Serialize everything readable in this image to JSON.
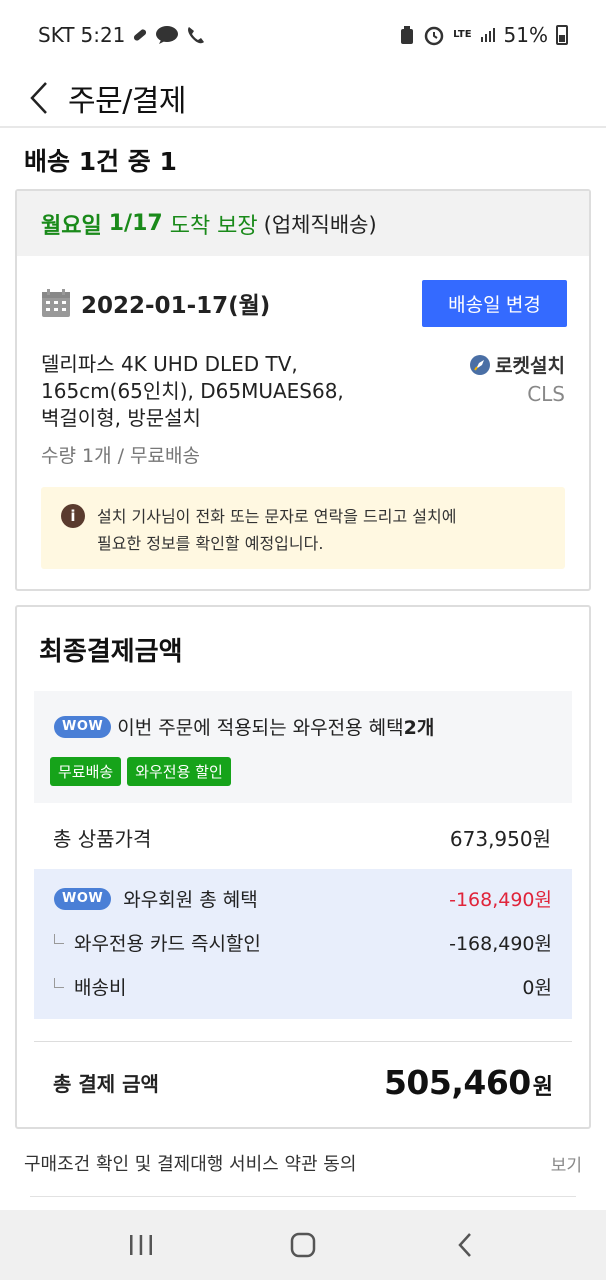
{
  "status_bar": {
    "carrier": "SKT",
    "time": "5:21",
    "talk_icon_label": "TALK",
    "lte_label": "LTE",
    "battery_percent": "51%"
  },
  "header": {
    "title": "주문/결제"
  },
  "shipment": {
    "count_label": "배송 1건 중 1",
    "guarantee": {
      "day": "월요일",
      "date": "1/17",
      "label": "도착 보장",
      "type": "(업체직배송)"
    },
    "delivery_date": "2022-01-17(월)",
    "change_button": "배송일 변경",
    "product_lines": [
      "델리파스 4K UHD DLED TV,",
      "165cm(65인치), D65MUAES68,",
      "벽걸이형, 방문설치"
    ],
    "rocket_install": "로켓설치",
    "carrier_code": "CLS",
    "quantity": "수량 1개 / 무료배송",
    "notice_lines": [
      "설치 기사님이 전화 또는 문자로 연락을 드리고 설치에",
      "필요한 정보를 확인할 예정입니다."
    ]
  },
  "payment": {
    "title": "최종결제금액",
    "wow_badge": "WOW",
    "wow_text": "이번 주문에 적용되는 와우전용 혜택",
    "wow_count": "2개",
    "tags": [
      "무료배송",
      "와우전용 할인"
    ],
    "product_total_label": "총 상품가격",
    "product_total_value": "673,950원",
    "member_benefit_label": "와우회원 총 혜택",
    "member_benefit_value": "-168,490원",
    "card_discount_label": "와우전용 카드 즉시할인",
    "card_discount_value": "-168,490원",
    "shipping_label": "배송비",
    "shipping_value": "0원",
    "grand_total_label": "총 결제 금액",
    "grand_total_number": "505,460",
    "grand_total_unit": "원"
  },
  "agreement": {
    "text": "구매조건 확인 및 결제대행 서비스 약관 동의",
    "view_link": "보기"
  },
  "colors": {
    "accent_blue": "#346aff",
    "guarantee_green": "#1a8a1a",
    "tag_green": "#16a31a",
    "discount_red": "#e0243a"
  }
}
